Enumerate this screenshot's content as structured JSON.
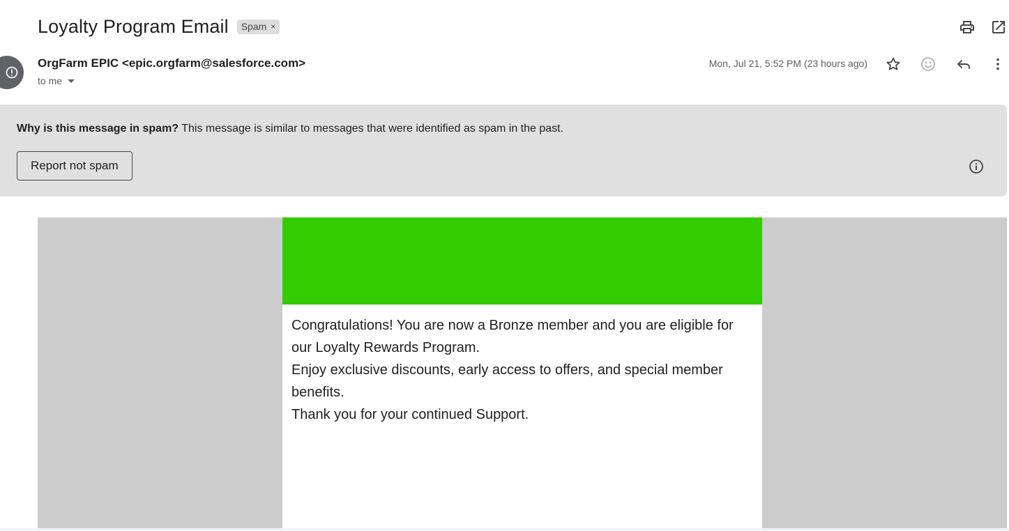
{
  "email": {
    "subject": "Loyalty Program Email",
    "label_chip": "Spam",
    "label_remove_glyph": "×",
    "sender_display": "OrgFarm EPIC <epic.orgfarm@salesforce.com>",
    "recipient_text": "to me",
    "date": "Mon, Jul 21, 5:52 PM (23 hours ago)"
  },
  "toolbar": {
    "icons": [
      "print-icon",
      "open-in-new-window-icon"
    ]
  },
  "message_actions": {
    "icons": [
      "star-icon",
      "emoji-reaction-icon",
      "reply-icon",
      "more-options-icon"
    ]
  },
  "spam_banner": {
    "question": "Why is this message in spam?",
    "explanation": " This message is similar to messages that were identified as spam in the past.",
    "button_label": "Report not spam"
  },
  "body": {
    "banner_color": "#33cc00",
    "line1": "Congratulations! You are now a Bronze member and you are eligible for our Loyalty Rewards Program.",
    "line2": "Enjoy exclusive discounts, early access to offers, and special member benefits.",
    "line3": "Thank you for your continued Support."
  },
  "colors": {
    "spam_banner_bg": "#e0e0e0",
    "email_side_bg": "#cccccc",
    "avatar_bg": "#5f6368"
  }
}
